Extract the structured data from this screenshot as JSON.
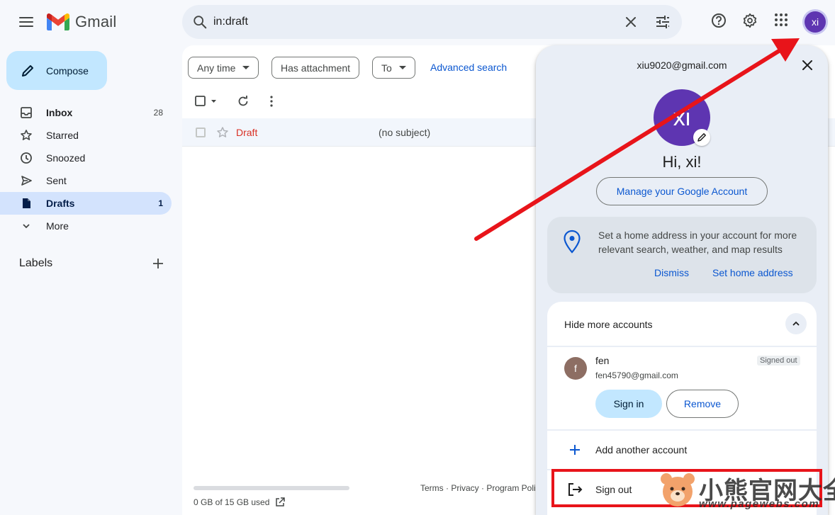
{
  "app": {
    "name": "Gmail"
  },
  "search": {
    "value": "in:draft"
  },
  "sidebar": {
    "compose_label": "Compose",
    "items": [
      {
        "label": "Inbox",
        "count": "28",
        "icon": "inbox-icon"
      },
      {
        "label": "Starred",
        "count": "",
        "icon": "star-icon"
      },
      {
        "label": "Snoozed",
        "count": "",
        "icon": "clock-icon"
      },
      {
        "label": "Sent",
        "count": "",
        "icon": "send-icon"
      },
      {
        "label": "Drafts",
        "count": "1",
        "icon": "draft-icon"
      },
      {
        "label": "More",
        "count": "",
        "icon": "chevron-down-icon"
      }
    ],
    "labels_heading": "Labels"
  },
  "filters": {
    "any_time": "Any time",
    "has_attachment": "Has attachment",
    "to": "To",
    "advanced_search": "Advanced search"
  },
  "messages": [
    {
      "sender": "Draft",
      "subject": "(no subject)"
    }
  ],
  "footer": {
    "storage": "0 GB of 15 GB used",
    "storage_used_fraction": 0,
    "links": "Terms · Privacy · Program Policies"
  },
  "account_panel": {
    "email": "xiu9020@gmail.com",
    "avatar_initials": "xi",
    "greeting": "Hi, xi!",
    "manage_label": "Manage your Google Account",
    "home_card": {
      "message": "Set a home address in your account for more relevant search, weather, and map results",
      "dismiss": "Dismiss",
      "set_home": "Set home address"
    },
    "accounts_toggle": "Hide more accounts",
    "other_account": {
      "initial": "f",
      "name": "fen",
      "email": "fen45790@gmail.com",
      "status": "Signed out",
      "sign_in": "Sign in",
      "remove": "Remove"
    },
    "add_account": "Add another account",
    "sign_out": "Sign out"
  },
  "header": {
    "avatar_initials": "xi"
  },
  "watermark": {
    "cn": "小熊官网大全",
    "url": "www.pagewebs.com"
  },
  "colors": {
    "accent": "#0b57d0",
    "avatar": "#5e35b1",
    "annotation": "#e8141a",
    "draft_label": "#d93025"
  }
}
